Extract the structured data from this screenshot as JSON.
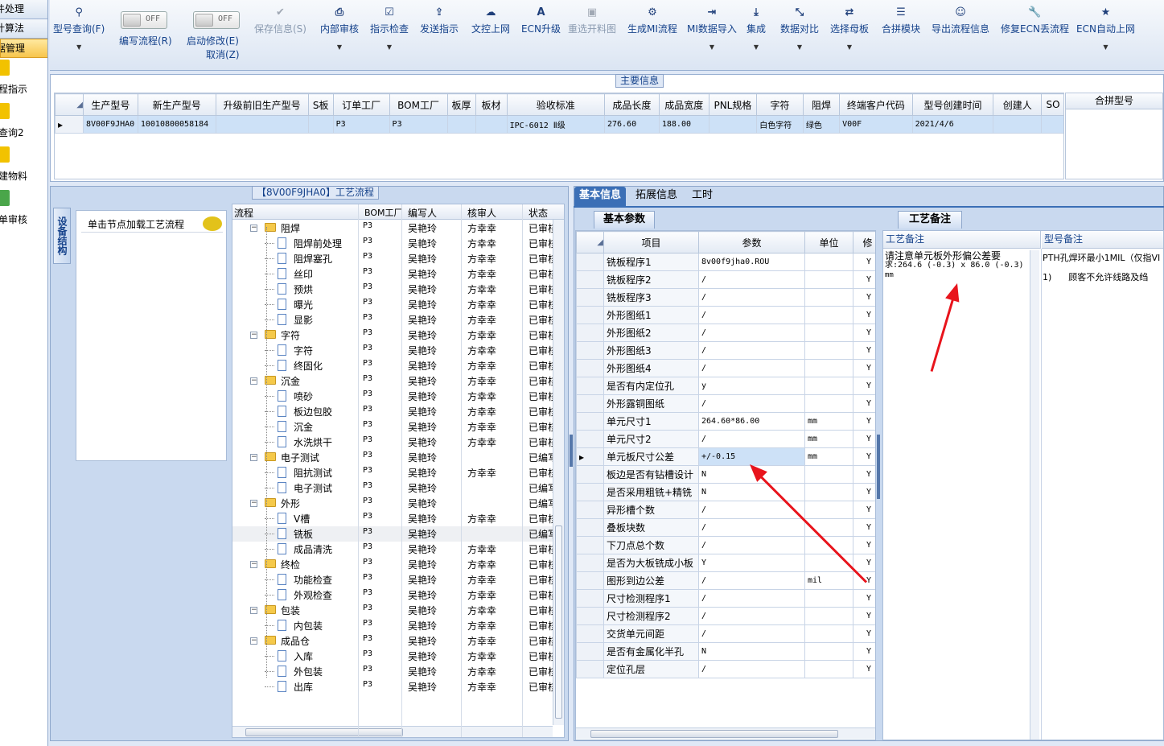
{
  "left_nav": {
    "buttons": [
      "件处理",
      "计算法",
      "据管理"
    ],
    "items": [
      "程指示",
      "查询2",
      "建物料",
      "单审核"
    ]
  },
  "toolbar": [
    {
      "label": "型号查询(F)",
      "icon": "search-icon",
      "glyph": "⚲",
      "dropdown": true,
      "disabled": false
    },
    {
      "label": "编写流程(R)",
      "icon": "toggle",
      "toggle": "OFF"
    },
    {
      "label": "启动修改(E)",
      "sublabel": "取消(Z)",
      "icon": "toggle",
      "toggle": "OFF"
    },
    {
      "label": "保存信息(S)",
      "icon": "check-icon",
      "glyph": "✔",
      "disabled": true
    },
    {
      "label": "内部审核",
      "icon": "print-icon",
      "glyph": "⎙",
      "dropdown": true
    },
    {
      "label": "指示检查",
      "icon": "checkbox-icon",
      "glyph": "☑",
      "dropdown": true
    },
    {
      "label": "发送指示",
      "icon": "upload-icon",
      "glyph": "⇪"
    },
    {
      "label": "文控上网",
      "icon": "cloud-upload-icon",
      "glyph": "☁"
    },
    {
      "label": "ECN升级",
      "icon": "font-icon",
      "glyph": "A"
    },
    {
      "label": "重选开料图",
      "icon": "image-icon",
      "glyph": "▣",
      "disabled": true
    },
    {
      "label": "生成MI流程",
      "icon": "cogs-icon",
      "glyph": "⚙"
    },
    {
      "label": "MI数据导入",
      "icon": "sign-in-icon",
      "glyph": "⇥",
      "dropdown": true
    },
    {
      "label": "集成",
      "icon": "download-icon",
      "glyph": "⤓",
      "dropdown": true
    },
    {
      "label": "数据对比",
      "icon": "compress-icon",
      "glyph": "⤡",
      "dropdown": true
    },
    {
      "label": "选择母板",
      "icon": "random-icon",
      "glyph": "⇄",
      "dropdown": true
    },
    {
      "label": "合拼模块",
      "icon": "list-icon",
      "glyph": "☰"
    },
    {
      "label": "导出流程信息",
      "icon": "smile-icon",
      "glyph": "☺"
    },
    {
      "label": "修复ECN丢流程",
      "icon": "wrench-icon",
      "glyph": "🔧"
    },
    {
      "label": "ECN自动上网",
      "icon": "star-icon",
      "glyph": "★",
      "dropdown": true
    }
  ],
  "main_info": {
    "legend": "主要信息",
    "columns": [
      "生产型号",
      "新生产型号",
      "升级前旧生产型号",
      "S板",
      "订单工厂",
      "BOM工厂",
      "板厚",
      "板材",
      "验收标准",
      "成品长度",
      "成品宽度",
      "PNL规格",
      "字符",
      "阻焊",
      "终端客户代码",
      "型号创建时间",
      "创建人",
      "SO"
    ],
    "row": [
      "8V00F9JHA0",
      "10010800058184",
      "",
      "",
      "P3",
      "P3",
      "",
      "",
      "IPC-6012 Ⅱ级",
      "276.60",
      "188.00",
      "",
      "白色字符",
      "绿色",
      "V00F",
      "2021/4/6",
      "",
      ""
    ],
    "side_header": "合拼型号"
  },
  "process": {
    "legend": "【8V00F9JHA0】工艺流程",
    "side_tab": "设备结构",
    "load_hint": "单击节点加载工艺流程",
    "columns": [
      "流程",
      "BOM工厂",
      "编写人",
      "核审人",
      "状态"
    ],
    "rows": [
      {
        "name": "阻焊",
        "level": 0,
        "bom": "P3",
        "writer": "吴艳玲",
        "reviewer": "方幸幸",
        "status": "已审核"
      },
      {
        "name": "阻焊前处理",
        "level": 1,
        "bom": "P3",
        "writer": "吴艳玲",
        "reviewer": "方幸幸",
        "status": "已审核"
      },
      {
        "name": "阻焊塞孔",
        "level": 1,
        "bom": "P3",
        "writer": "吴艳玲",
        "reviewer": "方幸幸",
        "status": "已审核"
      },
      {
        "name": "丝印",
        "level": 1,
        "bom": "P3",
        "writer": "吴艳玲",
        "reviewer": "方幸幸",
        "status": "已审核"
      },
      {
        "name": "预烘",
        "level": 1,
        "bom": "P3",
        "writer": "吴艳玲",
        "reviewer": "方幸幸",
        "status": "已审核"
      },
      {
        "name": "曝光",
        "level": 1,
        "bom": "P3",
        "writer": "吴艳玲",
        "reviewer": "方幸幸",
        "status": "已审核"
      },
      {
        "name": "显影",
        "level": 1,
        "bom": "P3",
        "writer": "吴艳玲",
        "reviewer": "方幸幸",
        "status": "已审核"
      },
      {
        "name": "字符",
        "level": 0,
        "bom": "P3",
        "writer": "吴艳玲",
        "reviewer": "方幸幸",
        "status": "已审核"
      },
      {
        "name": "字符",
        "level": 1,
        "bom": "P3",
        "writer": "吴艳玲",
        "reviewer": "方幸幸",
        "status": "已审核"
      },
      {
        "name": "终固化",
        "level": 1,
        "bom": "P3",
        "writer": "吴艳玲",
        "reviewer": "方幸幸",
        "status": "已审核"
      },
      {
        "name": "沉金",
        "level": 0,
        "bom": "P3",
        "writer": "吴艳玲",
        "reviewer": "方幸幸",
        "status": "已审核"
      },
      {
        "name": "喷砂",
        "level": 1,
        "bom": "P3",
        "writer": "吴艳玲",
        "reviewer": "方幸幸",
        "status": "已审核"
      },
      {
        "name": "板边包胶",
        "level": 1,
        "bom": "P3",
        "writer": "吴艳玲",
        "reviewer": "方幸幸",
        "status": "已审核"
      },
      {
        "name": "沉金",
        "level": 1,
        "bom": "P3",
        "writer": "吴艳玲",
        "reviewer": "方幸幸",
        "status": "已审核"
      },
      {
        "name": "水洗烘干",
        "level": 1,
        "bom": "P3",
        "writer": "吴艳玲",
        "reviewer": "方幸幸",
        "status": "已审核"
      },
      {
        "name": "电子测试",
        "level": 0,
        "bom": "P3",
        "writer": "吴艳玲",
        "reviewer": "",
        "status": "已编写"
      },
      {
        "name": "阻抗测试",
        "level": 1,
        "bom": "P3",
        "writer": "吴艳玲",
        "reviewer": "方幸幸",
        "status": "已审核"
      },
      {
        "name": "电子测试",
        "level": 1,
        "bom": "P3",
        "writer": "吴艳玲",
        "reviewer": "",
        "status": "已编写"
      },
      {
        "name": "外形",
        "level": 0,
        "bom": "P3",
        "writer": "吴艳玲",
        "reviewer": "",
        "status": "已编写"
      },
      {
        "name": "V槽",
        "level": 1,
        "bom": "P3",
        "writer": "吴艳玲",
        "reviewer": "方幸幸",
        "status": "已审核"
      },
      {
        "name": "铣板",
        "level": 1,
        "bom": "P3",
        "writer": "吴艳玲",
        "reviewer": "",
        "status": "已编写",
        "selected": true
      },
      {
        "name": "成品清洗",
        "level": 1,
        "bom": "P3",
        "writer": "吴艳玲",
        "reviewer": "方幸幸",
        "status": "已审核"
      },
      {
        "name": "终检",
        "level": 0,
        "bom": "P3",
        "writer": "吴艳玲",
        "reviewer": "方幸幸",
        "status": "已审核"
      },
      {
        "name": "功能检查",
        "level": 1,
        "bom": "P3",
        "writer": "吴艳玲",
        "reviewer": "方幸幸",
        "status": "已审核"
      },
      {
        "name": "外观检查",
        "level": 1,
        "bom": "P3",
        "writer": "吴艳玲",
        "reviewer": "方幸幸",
        "status": "已审核"
      },
      {
        "name": "包装",
        "level": 0,
        "bom": "P3",
        "writer": "吴艳玲",
        "reviewer": "方幸幸",
        "status": "已审核"
      },
      {
        "name": "内包装",
        "level": 1,
        "bom": "P3",
        "writer": "吴艳玲",
        "reviewer": "方幸幸",
        "status": "已审核"
      },
      {
        "name": "成品仓",
        "level": 0,
        "bom": "P3",
        "writer": "吴艳玲",
        "reviewer": "方幸幸",
        "status": "已审核"
      },
      {
        "name": "入库",
        "level": 1,
        "bom": "P3",
        "writer": "吴艳玲",
        "reviewer": "方幸幸",
        "status": "已审核"
      },
      {
        "name": "外包装",
        "level": 1,
        "bom": "P3",
        "writer": "吴艳玲",
        "reviewer": "方幸幸",
        "status": "已审核"
      },
      {
        "name": "出库",
        "level": 1,
        "bom": "P3",
        "writer": "吴艳玲",
        "reviewer": "方幸幸",
        "status": "已审核"
      }
    ]
  },
  "tabs": [
    "基本信息",
    "拓展信息",
    "工时"
  ],
  "basic_params": {
    "title": "基本参数",
    "columns": [
      "项目",
      "参数",
      "单位",
      "修"
    ],
    "rows": [
      [
        "铣板程序1",
        "8v00f9jha0.ROU",
        "",
        "Y"
      ],
      [
        "铣板程序2",
        "/",
        "",
        "Y"
      ],
      [
        "铣板程序3",
        "/",
        "",
        "Y"
      ],
      [
        "外形图纸1",
        "/",
        "",
        "Y"
      ],
      [
        "外形图纸2",
        "/",
        "",
        "Y"
      ],
      [
        "外形图纸3",
        "/",
        "",
        "Y"
      ],
      [
        "外形图纸4",
        "/",
        "",
        "Y"
      ],
      [
        "是否有内定位孔",
        "y",
        "",
        "Y"
      ],
      [
        "外形露铜图纸",
        "/",
        "",
        "Y"
      ],
      [
        "单元尺寸1",
        "264.60*86.00",
        "mm",
        "Y"
      ],
      [
        "单元尺寸2",
        "/",
        "mm",
        "Y"
      ],
      [
        "单元板尺寸公差",
        "+/-0.15",
        "mm",
        "Y"
      ],
      [
        "板边是否有钻槽设计",
        "N",
        "",
        "Y"
      ],
      [
        "是否采用粗铣+精铣",
        "N",
        "",
        "Y"
      ],
      [
        "异形槽个数",
        "/",
        "",
        "Y"
      ],
      [
        "叠板块数",
        "/",
        "",
        "Y"
      ],
      [
        "下刀点总个数",
        "/",
        "",
        "Y"
      ],
      [
        "是否为大板铣成小板",
        "Y",
        "",
        "Y"
      ],
      [
        "图形到边公差",
        "/",
        "mil",
        "Y"
      ],
      [
        "尺寸检测程序1",
        "/",
        "",
        "Y"
      ],
      [
        "尺寸检测程序2",
        "/",
        "",
        "Y"
      ],
      [
        "交货单元间距",
        "/",
        "",
        "Y"
      ],
      [
        "是否有金属化半孔",
        "N",
        "",
        "Y"
      ],
      [
        "定位孔层",
        "/",
        "",
        "Y"
      ]
    ],
    "selected_index": 11
  },
  "memo": {
    "title": "工艺备注",
    "col1_header": "工艺备注",
    "col2_header": "型号备注",
    "col1_line1": "请注意单元板外形偏公差要",
    "col1_line2": "求:264.6 (-0.3) x 86.0 (-0.3)",
    "col1_line3": "mm",
    "col2_line1": "PTH孔焊环最小1MIL（仅指VI",
    "col2_line2": "1)      顾客不允许线路及绉"
  },
  "colors": {
    "accent": "#3b6fb6",
    "arrow": "#e8141c",
    "selection": "#cde1f7"
  }
}
